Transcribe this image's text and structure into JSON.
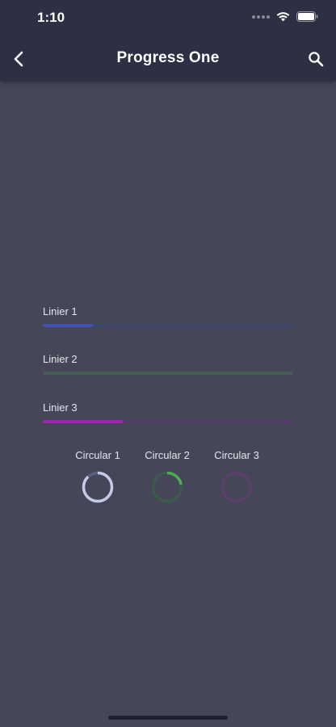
{
  "status_bar": {
    "time": "1:10"
  },
  "header": {
    "title": "Progress One"
  },
  "linear": [
    {
      "label": "Linier 1",
      "progress": 0.2,
      "track_color": "#40476c",
      "fill_color": "#3f51b5"
    },
    {
      "label": "Linier 2",
      "progress": 0.0,
      "track_color": "#465a56",
      "fill_color": "#4caf50"
    },
    {
      "label": "Linier 3",
      "progress": 0.32,
      "track_color": "#553d6a",
      "fill_color": "#9c27b0"
    }
  ],
  "circular": [
    {
      "label": "Circular 1",
      "progress": 0.88,
      "track_color": "#5b5f86",
      "fill_color": "#c5cae9"
    },
    {
      "label": "Circular 2",
      "progress": 0.22,
      "track_color": "#3c5a4b",
      "fill_color": "#4caf50"
    },
    {
      "label": "Circular 3",
      "progress": 0.0,
      "track_color": "#5a3f6c",
      "fill_color": "#9c27b0"
    }
  ],
  "colors": {
    "background": "#454658",
    "app_bar": "#2d2f42"
  }
}
